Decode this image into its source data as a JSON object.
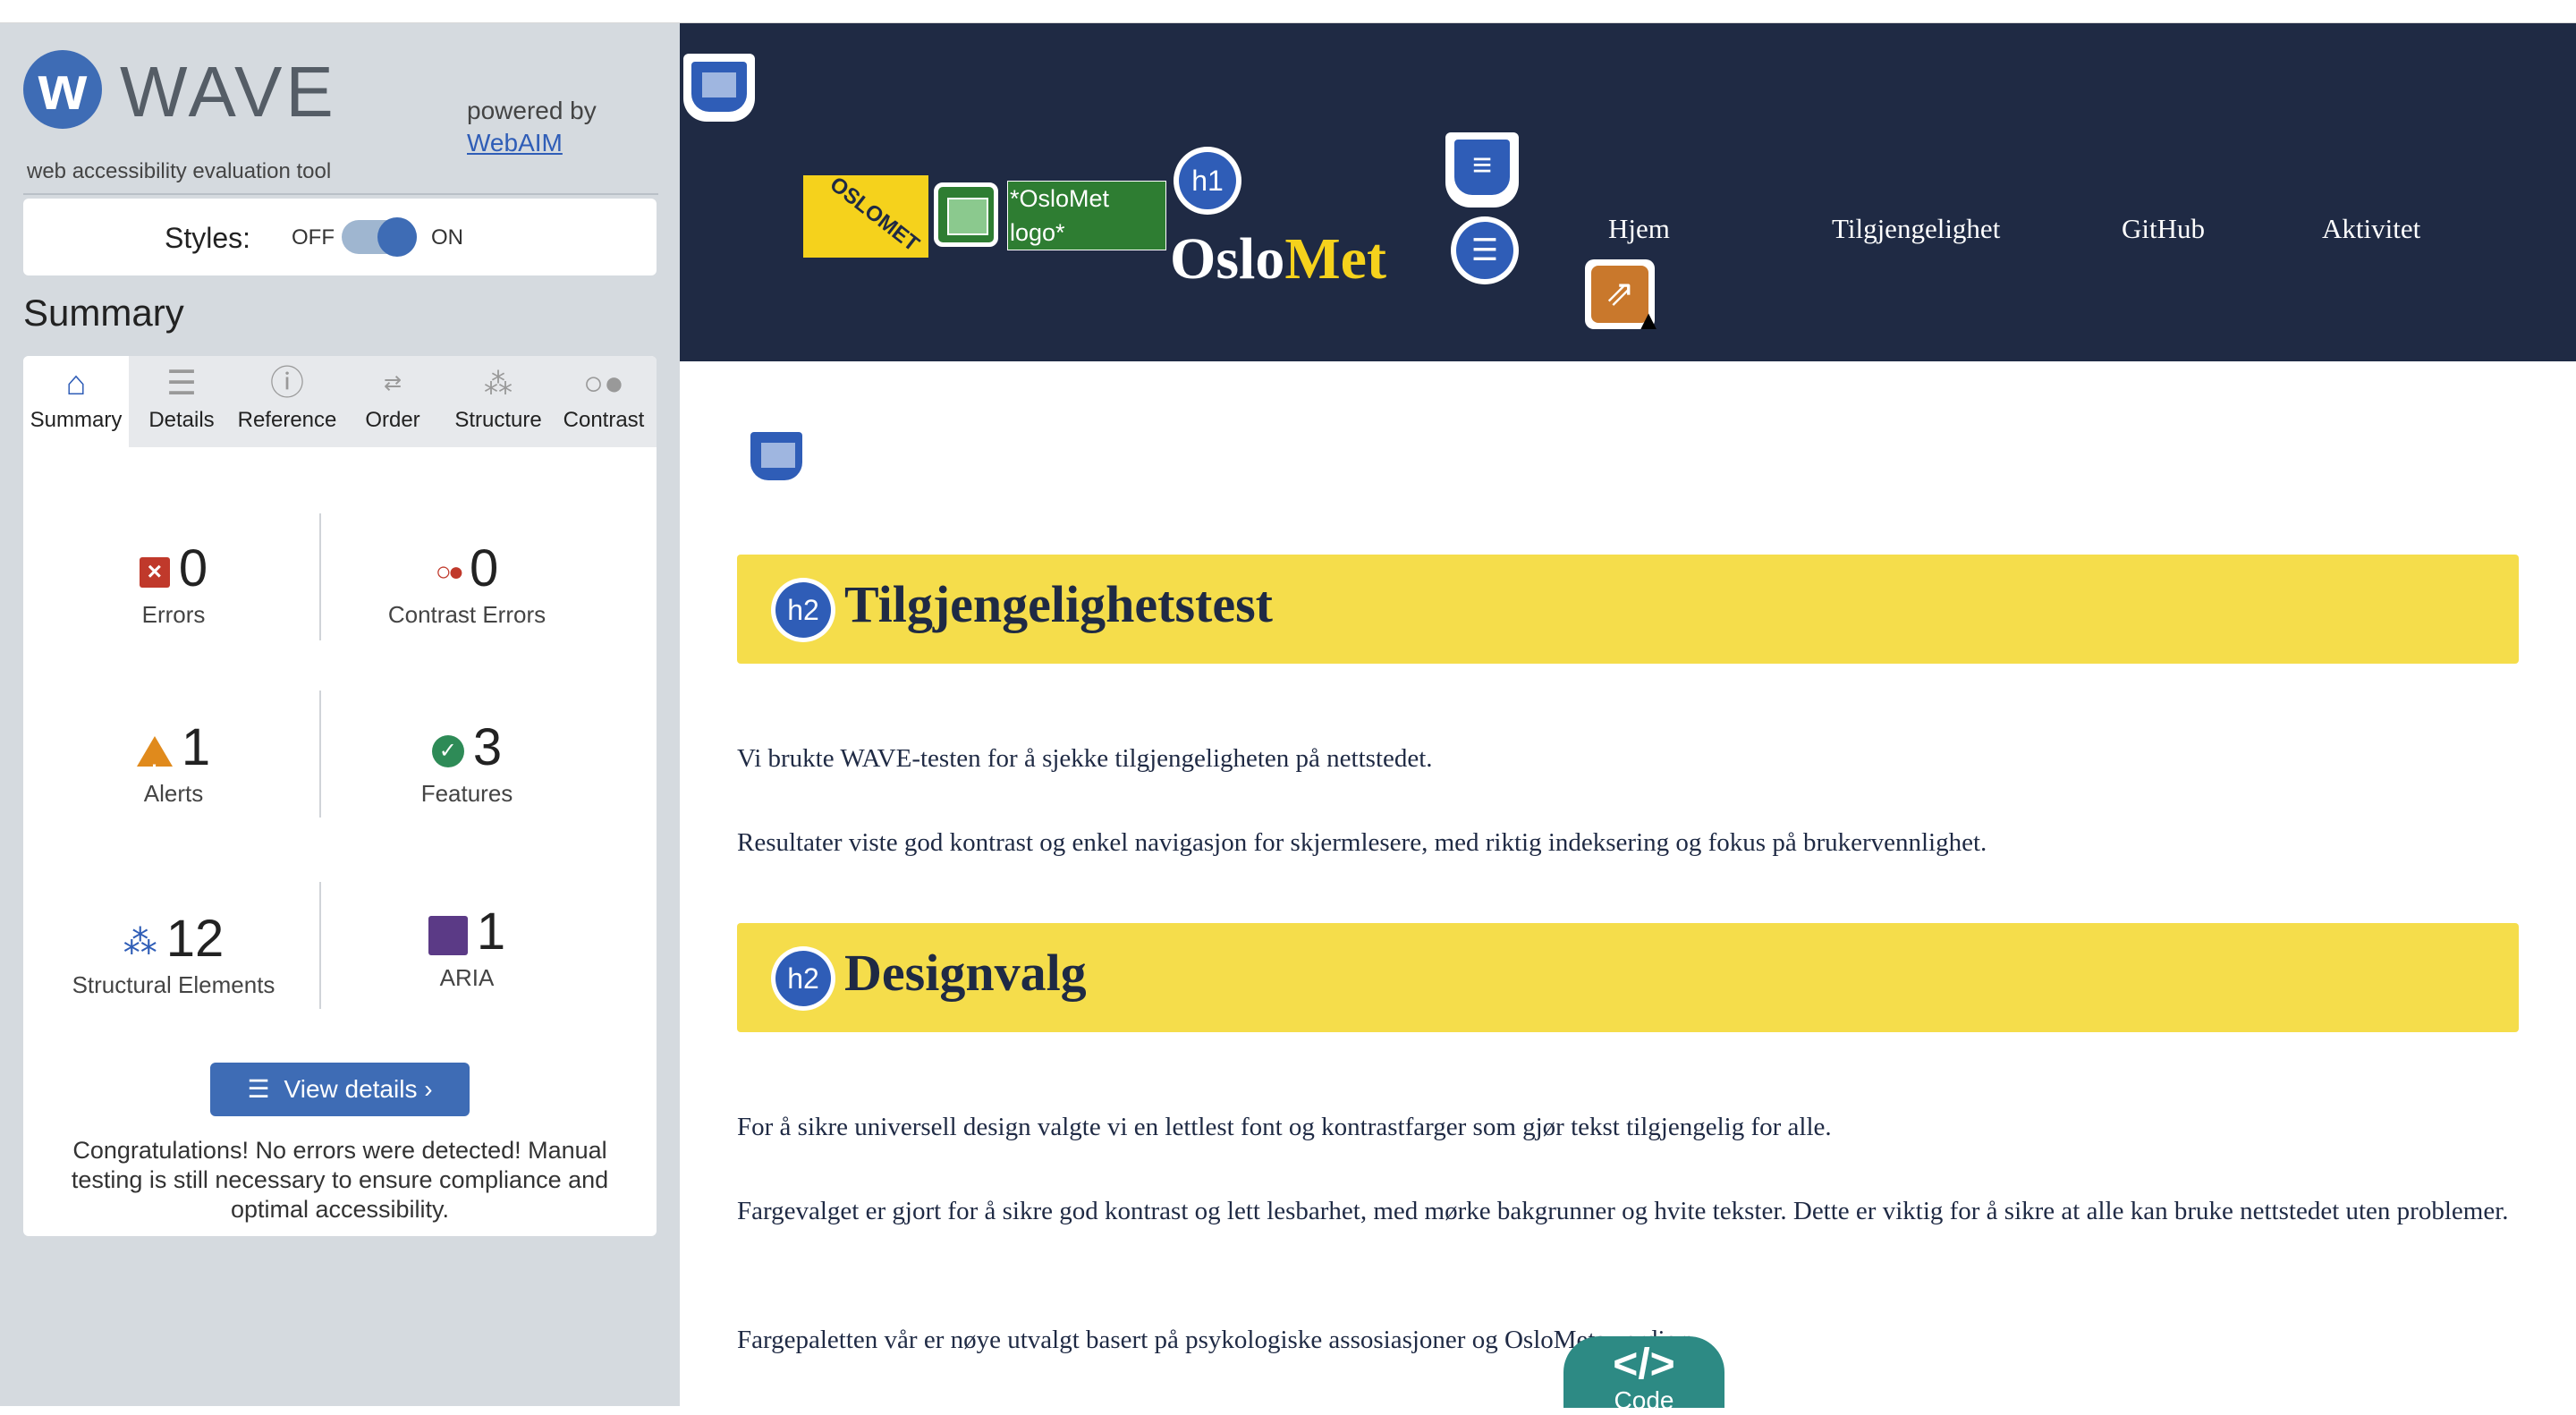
{
  "wave": {
    "logo_letter": "w",
    "title": "WAVE",
    "tagline": "web accessibility evaluation tool",
    "powered_by": "powered by",
    "webaim_link": "WebAIM",
    "styles": {
      "label": "Styles:",
      "off": "OFF",
      "on": "ON",
      "state": "on"
    },
    "summary_heading": "Summary",
    "tabs": [
      {
        "label": "Summary",
        "icon": "home-icon",
        "active": true
      },
      {
        "label": "Details",
        "icon": "list-icon",
        "active": false
      },
      {
        "label": "Reference",
        "icon": "info-icon",
        "active": false
      },
      {
        "label": "Order",
        "icon": "order-icon",
        "active": false
      },
      {
        "label": "Structure",
        "icon": "structure-icon",
        "active": false
      },
      {
        "label": "Contrast",
        "icon": "contrast-icon",
        "active": false
      }
    ],
    "stats": {
      "errors": {
        "count": "0",
        "label": "Errors"
      },
      "contrast_errors": {
        "count": "0",
        "label": "Contrast Errors"
      },
      "alerts": {
        "count": "1",
        "label": "Alerts"
      },
      "features": {
        "count": "3",
        "label": "Features"
      },
      "structural": {
        "count": "12",
        "label": "Structural Elements"
      },
      "aria": {
        "count": "1",
        "label": "ARIA"
      }
    },
    "view_details": "View details ›",
    "congrats": "Congratulations! No errors were detected! Manual testing is still necessary to ensure compliance and optimal accessibility."
  },
  "page": {
    "logo_text": "OSLOMET",
    "alt_text": "*OsloMet logo*",
    "h1_badge": "h1",
    "brand": {
      "oslo": "Oslo",
      "met": "Met"
    },
    "nav": [
      "Hjem",
      "Tilgjengelighet",
      "GitHub",
      "Aktivitet"
    ],
    "sections": [
      {
        "badge": "h2",
        "title": "Tilgjengelighetstest",
        "paragraphs": [
          "Vi brukte WAVE-testen for å sjekke tilgjengeligheten på nettstedet.",
          "Resultater viste god kontrast og enkel navigasjon for skjermlesere, med riktig indeksering og fokus på brukervennlighet."
        ]
      },
      {
        "badge": "h2",
        "title": "Designvalg",
        "paragraphs": [
          "For å sikre universell design valgte vi en lettlest font og kontrastfarger som gjør tekst tilgjengelig for alle.",
          "Fargevalget er gjort for å sikre god kontrast og lett lesbarhet, med mørke bakgrunner og hvite tekster. Dette er viktig for å sikre at alle kan bruke nettstedet uten problemer.",
          "Fargepaletten vår er nøye utvalgt basert på psykologiske assosiasjoner og OsloMets verdier:"
        ]
      }
    ],
    "code_button": {
      "icon": "</>",
      "label": "Code"
    }
  },
  "colors": {
    "header_bg": "#1f2a44",
    "banner_bg": "#f5dd4b",
    "brand_yellow": "#f5d21c",
    "wave_blue": "#3e6cb5",
    "sidebar_bg": "#d5dadf"
  }
}
